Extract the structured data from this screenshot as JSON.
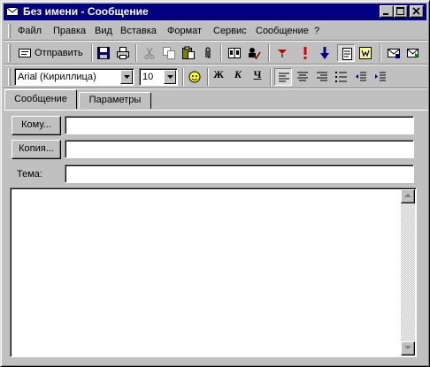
{
  "window": {
    "title": "Без имени - Сообщение"
  },
  "menu": {
    "items": [
      {
        "label": "Файл"
      },
      {
        "label": "Правка"
      },
      {
        "label": "Вид"
      },
      {
        "label": "Вставка"
      },
      {
        "label": "Формат"
      },
      {
        "label": "Сервис"
      },
      {
        "label": "Сообщение"
      },
      {
        "label": "?"
      }
    ]
  },
  "toolbar": {
    "send_label": "Отправить",
    "icons": [
      "send-icon",
      "save-icon",
      "print-icon",
      "cut-icon",
      "copy-icon",
      "paste-icon",
      "attach-icon",
      "address-book-icon",
      "check-names-icon",
      "flag-icon",
      "importance-high-icon",
      "importance-low-icon",
      "options-icon",
      "word-icon",
      "mail-icon",
      "mail-forward-icon"
    ]
  },
  "format_toolbar": {
    "font_name": "Arial (Кириллица)",
    "font_size": "10",
    "bold": "Ж",
    "italic": "К",
    "underline": "Ч"
  },
  "tabs": [
    {
      "label": "Сообщение",
      "active": true
    },
    {
      "label": "Параметры",
      "active": false
    }
  ],
  "header": {
    "to_button": "Кому...",
    "cc_button": "Копия...",
    "subject_label": "Тема:",
    "to_value": "",
    "cc_value": "",
    "subject_value": ""
  },
  "colors": {
    "titlebar": "#000080",
    "face": "#c0c0c0"
  }
}
